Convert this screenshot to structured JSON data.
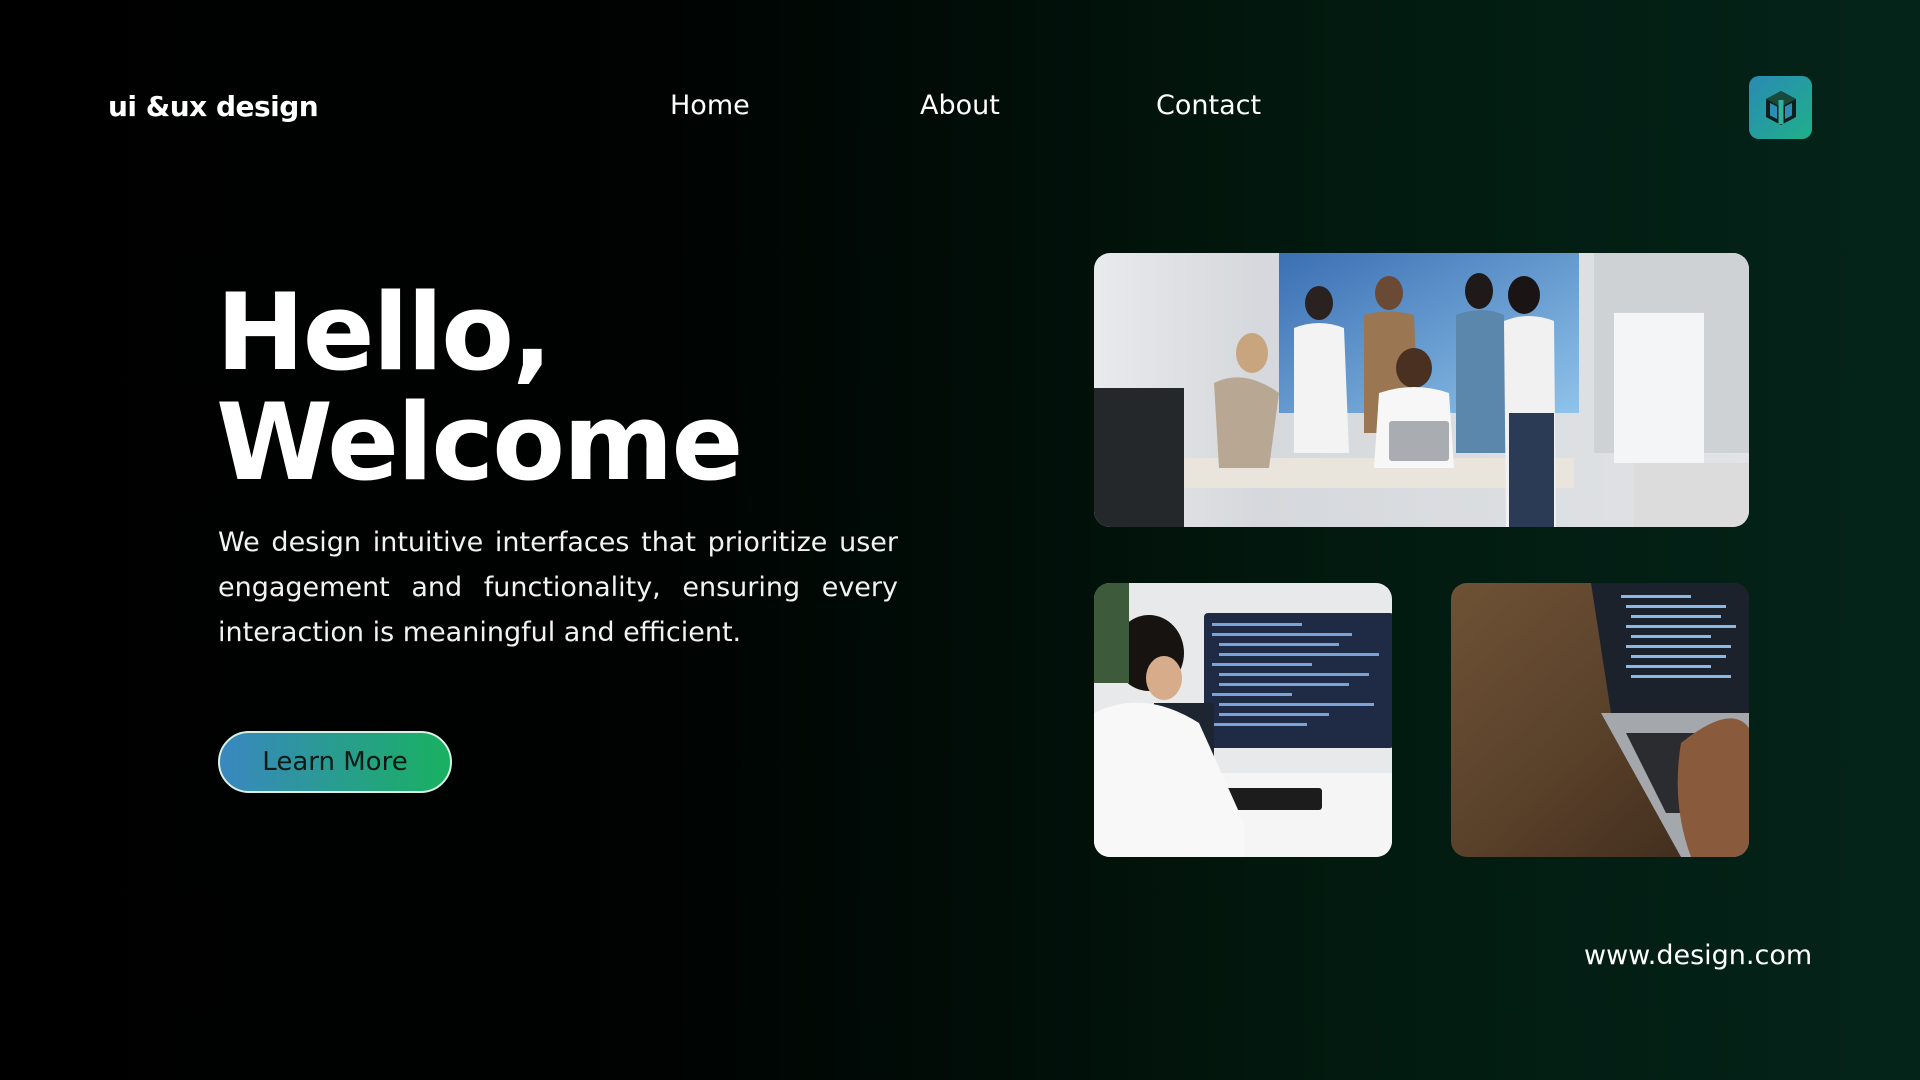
{
  "header": {
    "brand": "ui &ux design",
    "nav": [
      {
        "label": "Home"
      },
      {
        "label": "About"
      },
      {
        "label": "Contact"
      }
    ],
    "logo_icon": "cube-logo-icon"
  },
  "hero": {
    "title_line1": "Hello,",
    "title_line2": "Welcome",
    "description": "We design intuitive interfaces that prioritize user engagement and functionality, ensuring every interaction is meaningful and efficient.",
    "cta_label": "Learn More"
  },
  "images": [
    {
      "name": "team-meeting-photo"
    },
    {
      "name": "developer-at-monitor-photo"
    },
    {
      "name": "laptop-coding-photo"
    }
  ],
  "footer": {
    "url": "www.design.com"
  },
  "colors": {
    "accent_start": "#3a87c0",
    "accent_end": "#18b160",
    "background": "#000000"
  }
}
